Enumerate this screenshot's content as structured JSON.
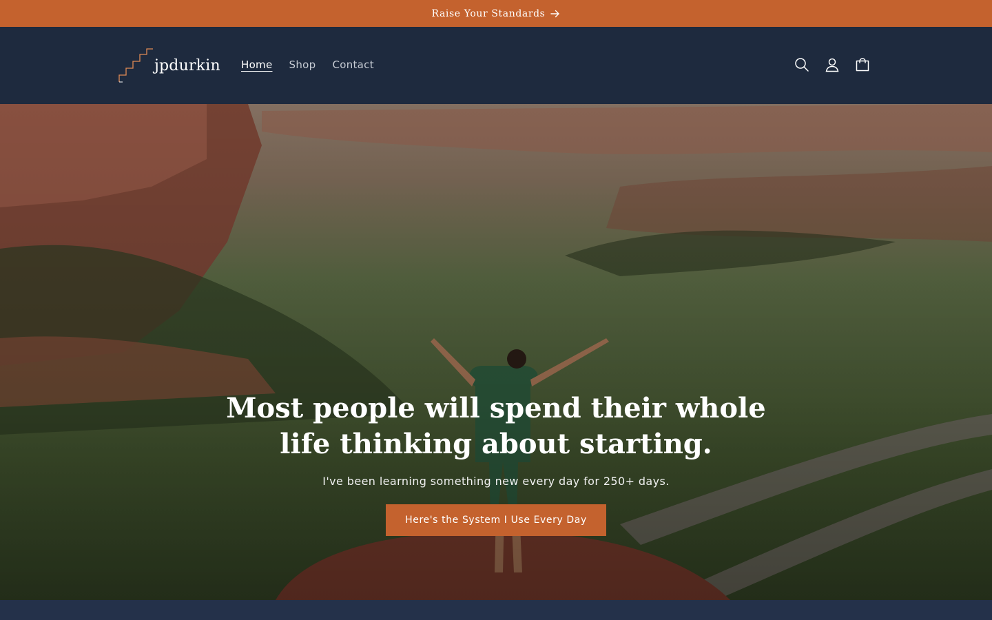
{
  "announcement": {
    "text": "Raise Your Standards",
    "icon": "arrow-right-icon",
    "background": "#c4622e"
  },
  "header": {
    "logo_text": "jpdurkin",
    "logo_icon": "staircase-logo-icon",
    "nav": [
      {
        "label": "Home",
        "active": true
      },
      {
        "label": "Shop",
        "active": false
      },
      {
        "label": "Contact",
        "active": false
      }
    ],
    "icons": [
      "search-icon",
      "account-icon",
      "cart-icon"
    ],
    "background": "#1e2a3e"
  },
  "hero": {
    "title": "Most people will spend their whole life thinking about starting.",
    "subtitle": "I've been learning something new every day for 250+ days.",
    "cta_label": "Here's the System I Use Every Day",
    "accent": "#c4622e"
  }
}
